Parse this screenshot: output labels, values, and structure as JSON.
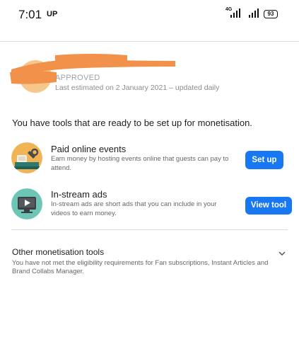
{
  "status_bar": {
    "time": "7:01",
    "network_label": "UP",
    "lte_label": "4G",
    "battery": "93"
  },
  "header": {
    "status": "APPROVED",
    "estimate": "Last estimated on 2 January 2021 – updated daily"
  },
  "intro": "You have tools that are ready to be set up for monetisation.",
  "tools": [
    {
      "title": "Paid online events",
      "description": "Earn money by hosting events online that guests can pay to attend.",
      "button": "Set up",
      "icon": "paid-events-icon"
    },
    {
      "title": "In-stream ads",
      "description": "In-stream ads are short ads that you can include in your videos to earn money.",
      "button": "View tool",
      "icon": "in-stream-ads-icon"
    }
  ],
  "other_tools": {
    "title": "Other monetisation tools",
    "description": "You have not met the eligibility requirements for Fan subscriptions, Instant Articles and Brand Collabs Manager."
  },
  "colors": {
    "primary_button": "#1877f2",
    "redaction": "#f2924a"
  }
}
